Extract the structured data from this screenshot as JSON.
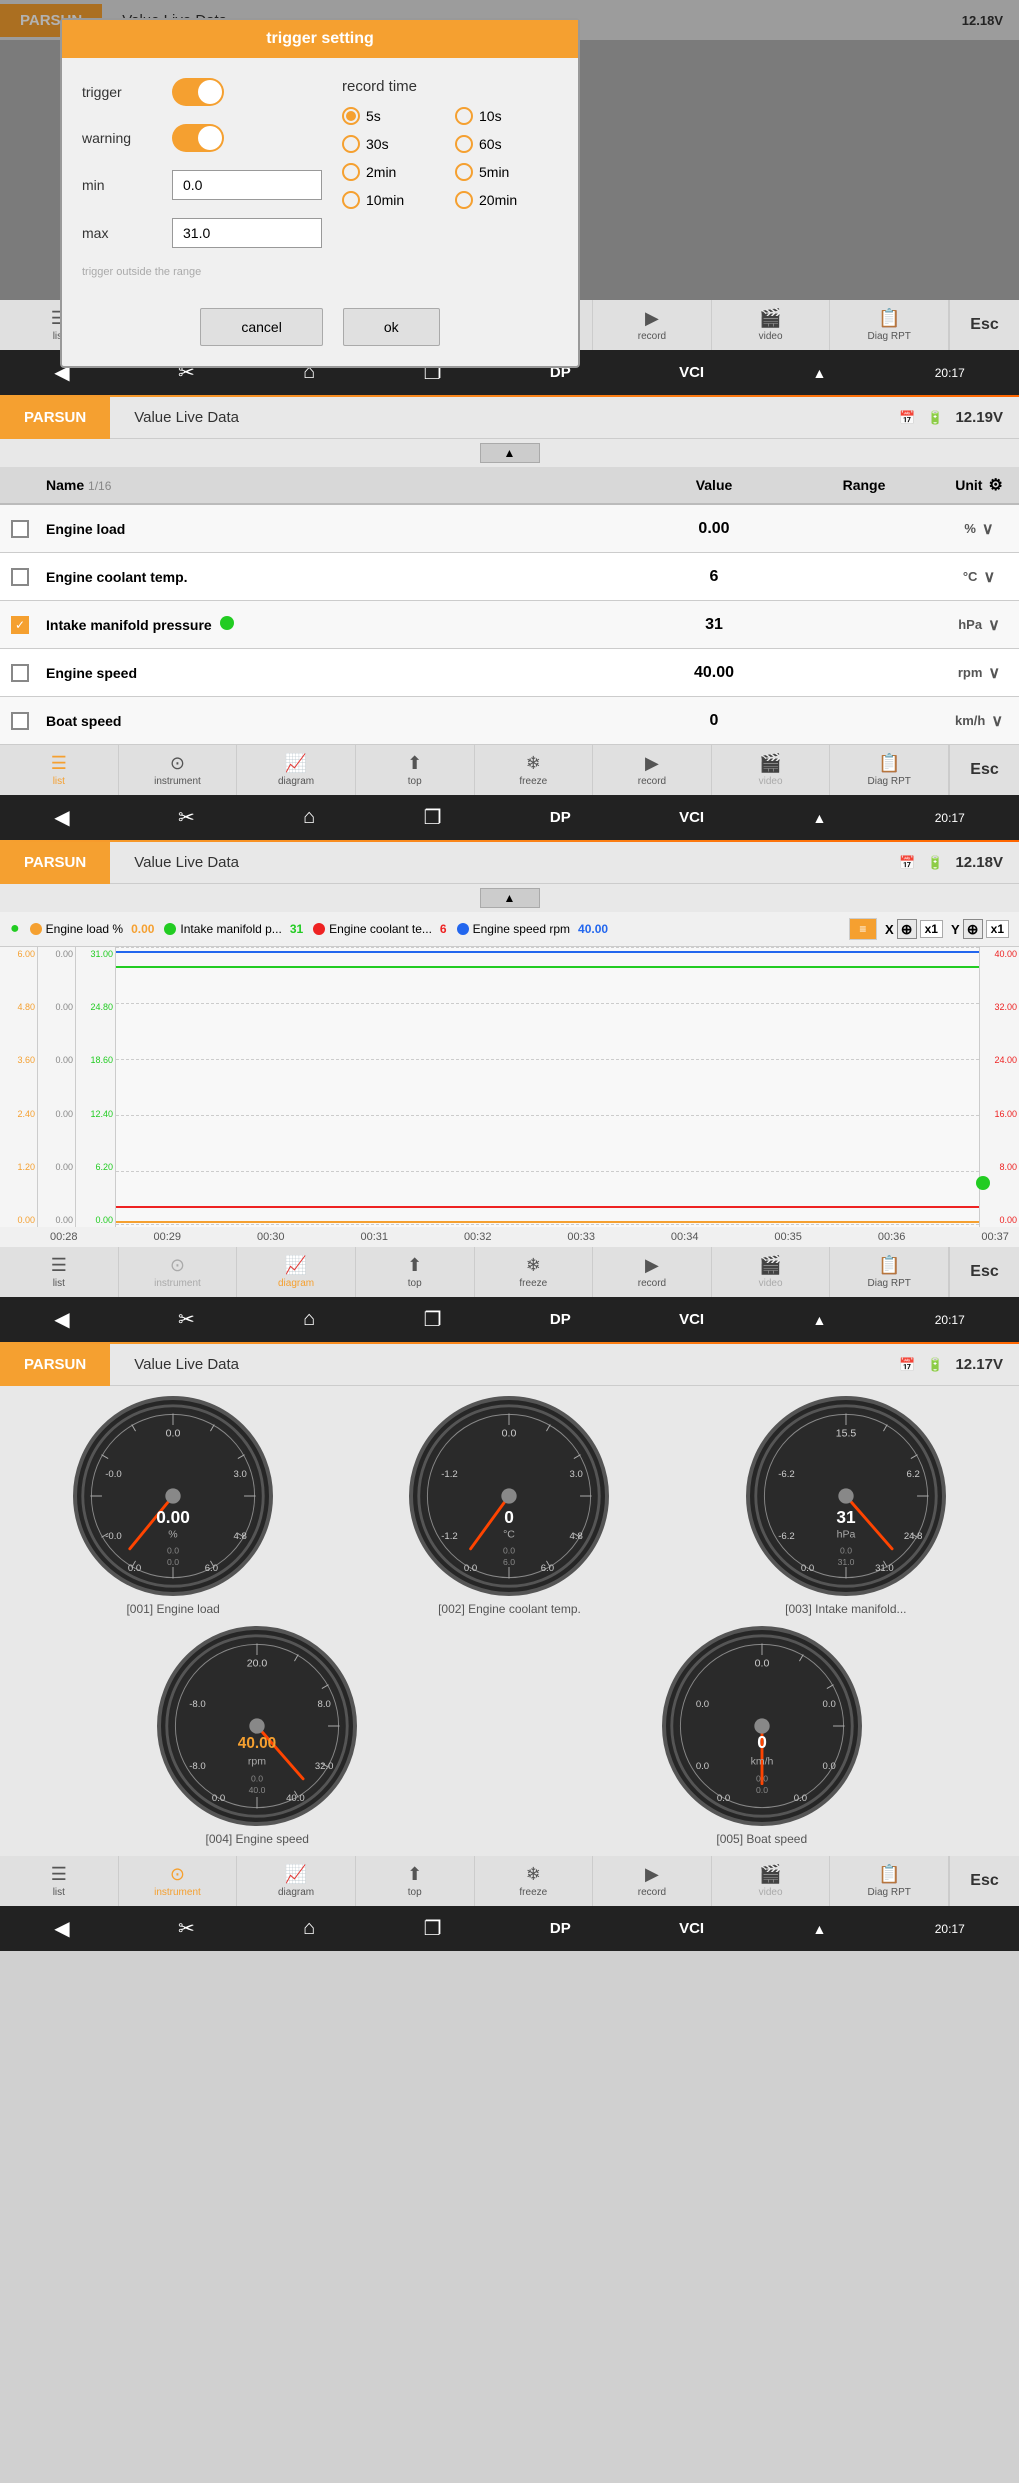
{
  "app": {
    "brand": "PARSUN",
    "title": "Value Live Data",
    "voltage1": "12.18V",
    "voltage2": "12.19V",
    "voltage3": "12.18V",
    "voltage4": "12.17V",
    "time": "20:17"
  },
  "dialog": {
    "title": "trigger setting",
    "trigger_label": "trigger",
    "warning_label": "warning",
    "min_label": "min",
    "max_label": "max",
    "min_value": "0.0",
    "max_value": "31.0",
    "hint": "trigger outside the range",
    "record_time_label": "record time",
    "radio_options": [
      "5s",
      "10s",
      "30s",
      "60s",
      "2min",
      "5min",
      "10min",
      "20min"
    ],
    "selected_radio": "5s",
    "cancel_label": "cancel",
    "ok_label": "ok"
  },
  "table": {
    "name_header": "Name",
    "page_info": "1/16",
    "value_header": "Value",
    "range_header": "Range",
    "unit_header": "Unit",
    "rows": [
      {
        "name": "Engine load",
        "value": "0.00",
        "range": "",
        "unit": "%",
        "checked": false
      },
      {
        "name": "Engine coolant temp.",
        "value": "6",
        "range": "",
        "unit": "°C",
        "checked": false
      },
      {
        "name": "Intake manifold pressure",
        "value": "31",
        "range": "",
        "unit": "hPa",
        "checked": true,
        "has_green_dot": true
      },
      {
        "name": "Engine speed",
        "value": "40.00",
        "range": "",
        "unit": "rpm",
        "checked": false
      },
      {
        "name": "Boat speed",
        "value": "0",
        "range": "",
        "unit": "km/h",
        "checked": false
      }
    ]
  },
  "toolbar": {
    "list_label": "list",
    "instrument_label": "instrument",
    "diagram_label": "diagram",
    "top_label": "top",
    "freeze_label": "freeze",
    "record_label": "record",
    "video_label": "video",
    "diag_rpt_label": "Diag RPT",
    "esc_label": "Esc"
  },
  "diagram": {
    "legend": [
      {
        "label": "Engine load %",
        "value": "0.00",
        "color": "#f5a030"
      },
      {
        "label": "Intake manifold p...",
        "value": "31",
        "color": "#22cc22"
      },
      {
        "label": "Engine coolant te...",
        "value": "6",
        "color": "#ee2222"
      },
      {
        "label": "Engine speed rpm",
        "value": "40.00",
        "color": "#2266ee"
      }
    ],
    "y_axes": {
      "orange": [
        "6.00",
        "4.80",
        "3.60",
        "2.40",
        "1.20",
        "0.00"
      ],
      "green": [
        "31.00",
        "24.80",
        "18.60",
        "12.40",
        "6.20",
        "0.00"
      ],
      "red_right1": [
        "40.00",
        "32.00",
        "24.00",
        "16.00",
        "8.00",
        "0.00"
      ],
      "orange_left2": [
        "0.00",
        "0.00",
        "0.00",
        "0.00",
        "0.00",
        "0.00"
      ]
    },
    "x_labels": [
      "00:28",
      "00:29",
      "00:30",
      "00:31",
      "00:32",
      "00:33",
      "00:34",
      "00:35",
      "00:36",
      "00:37"
    ]
  },
  "instruments": [
    {
      "id": "[001] Engine load",
      "unit": "%",
      "value": "0.00",
      "min": "0.0",
      "max": "6.0"
    },
    {
      "id": "[002] Engine coolant temp.",
      "unit": "°C",
      "value": "0",
      "min": "0.0",
      "max": "6.0"
    },
    {
      "id": "[003] Intake manifold...",
      "unit": "hPa",
      "value": "31",
      "min": "0.0",
      "max": "31.0",
      "has_green_dot": true
    },
    {
      "id": "[004] Engine speed",
      "unit": "rpm",
      "value": "40.00",
      "min": "0.0",
      "max": "40.0"
    },
    {
      "id": "[005] Boat speed",
      "unit": "km/h",
      "value": "0",
      "min": "0.0",
      "max": "0.0"
    }
  ]
}
